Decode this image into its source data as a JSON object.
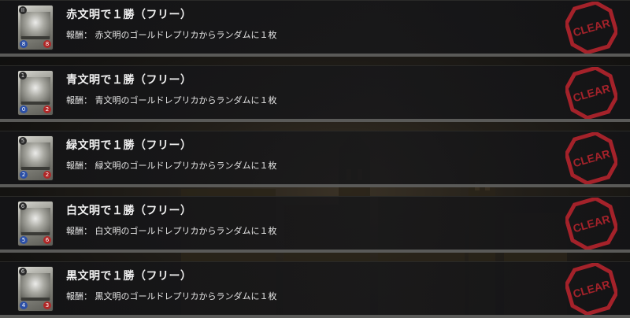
{
  "missions": [
    {
      "title": "赤文明で１勝（フリー）",
      "reward_label": "報酬：",
      "reward_text": "赤文明のゴールドレプリカからランダムに１枚",
      "card_cost": "II",
      "card_attack": "8",
      "card_defense": "8",
      "status": "CLEAR"
    },
    {
      "title": "青文明で１勝（フリー）",
      "reward_label": "報酬：",
      "reward_text": "青文明のゴールドレプリカからランダムに１枚",
      "card_cost": "1",
      "card_attack": "0",
      "card_defense": "2",
      "status": "CLEAR"
    },
    {
      "title": "緑文明で１勝（フリー）",
      "reward_label": "報酬：",
      "reward_text": "緑文明のゴールドレプリカからランダムに１枚",
      "card_cost": "5",
      "card_attack": "2",
      "card_defense": "2",
      "status": "CLEAR"
    },
    {
      "title": "白文明で１勝（フリー）",
      "reward_label": "報酬：",
      "reward_text": "白文明のゴールドレプリカからランダムに１枚",
      "card_cost": "6",
      "card_attack": "5",
      "card_defense": "6",
      "status": "CLEAR"
    },
    {
      "title": "黒文明で１勝（フリー）",
      "reward_label": "報酬：",
      "reward_text": "黒文明のゴールドレプリカからランダムに１枚",
      "card_cost": "6",
      "card_attack": "4",
      "card_defense": "3",
      "status": "CLEAR"
    }
  ],
  "colors": {
    "clear_stamp": "#a4222a",
    "row_divider": "#5a5a58"
  }
}
